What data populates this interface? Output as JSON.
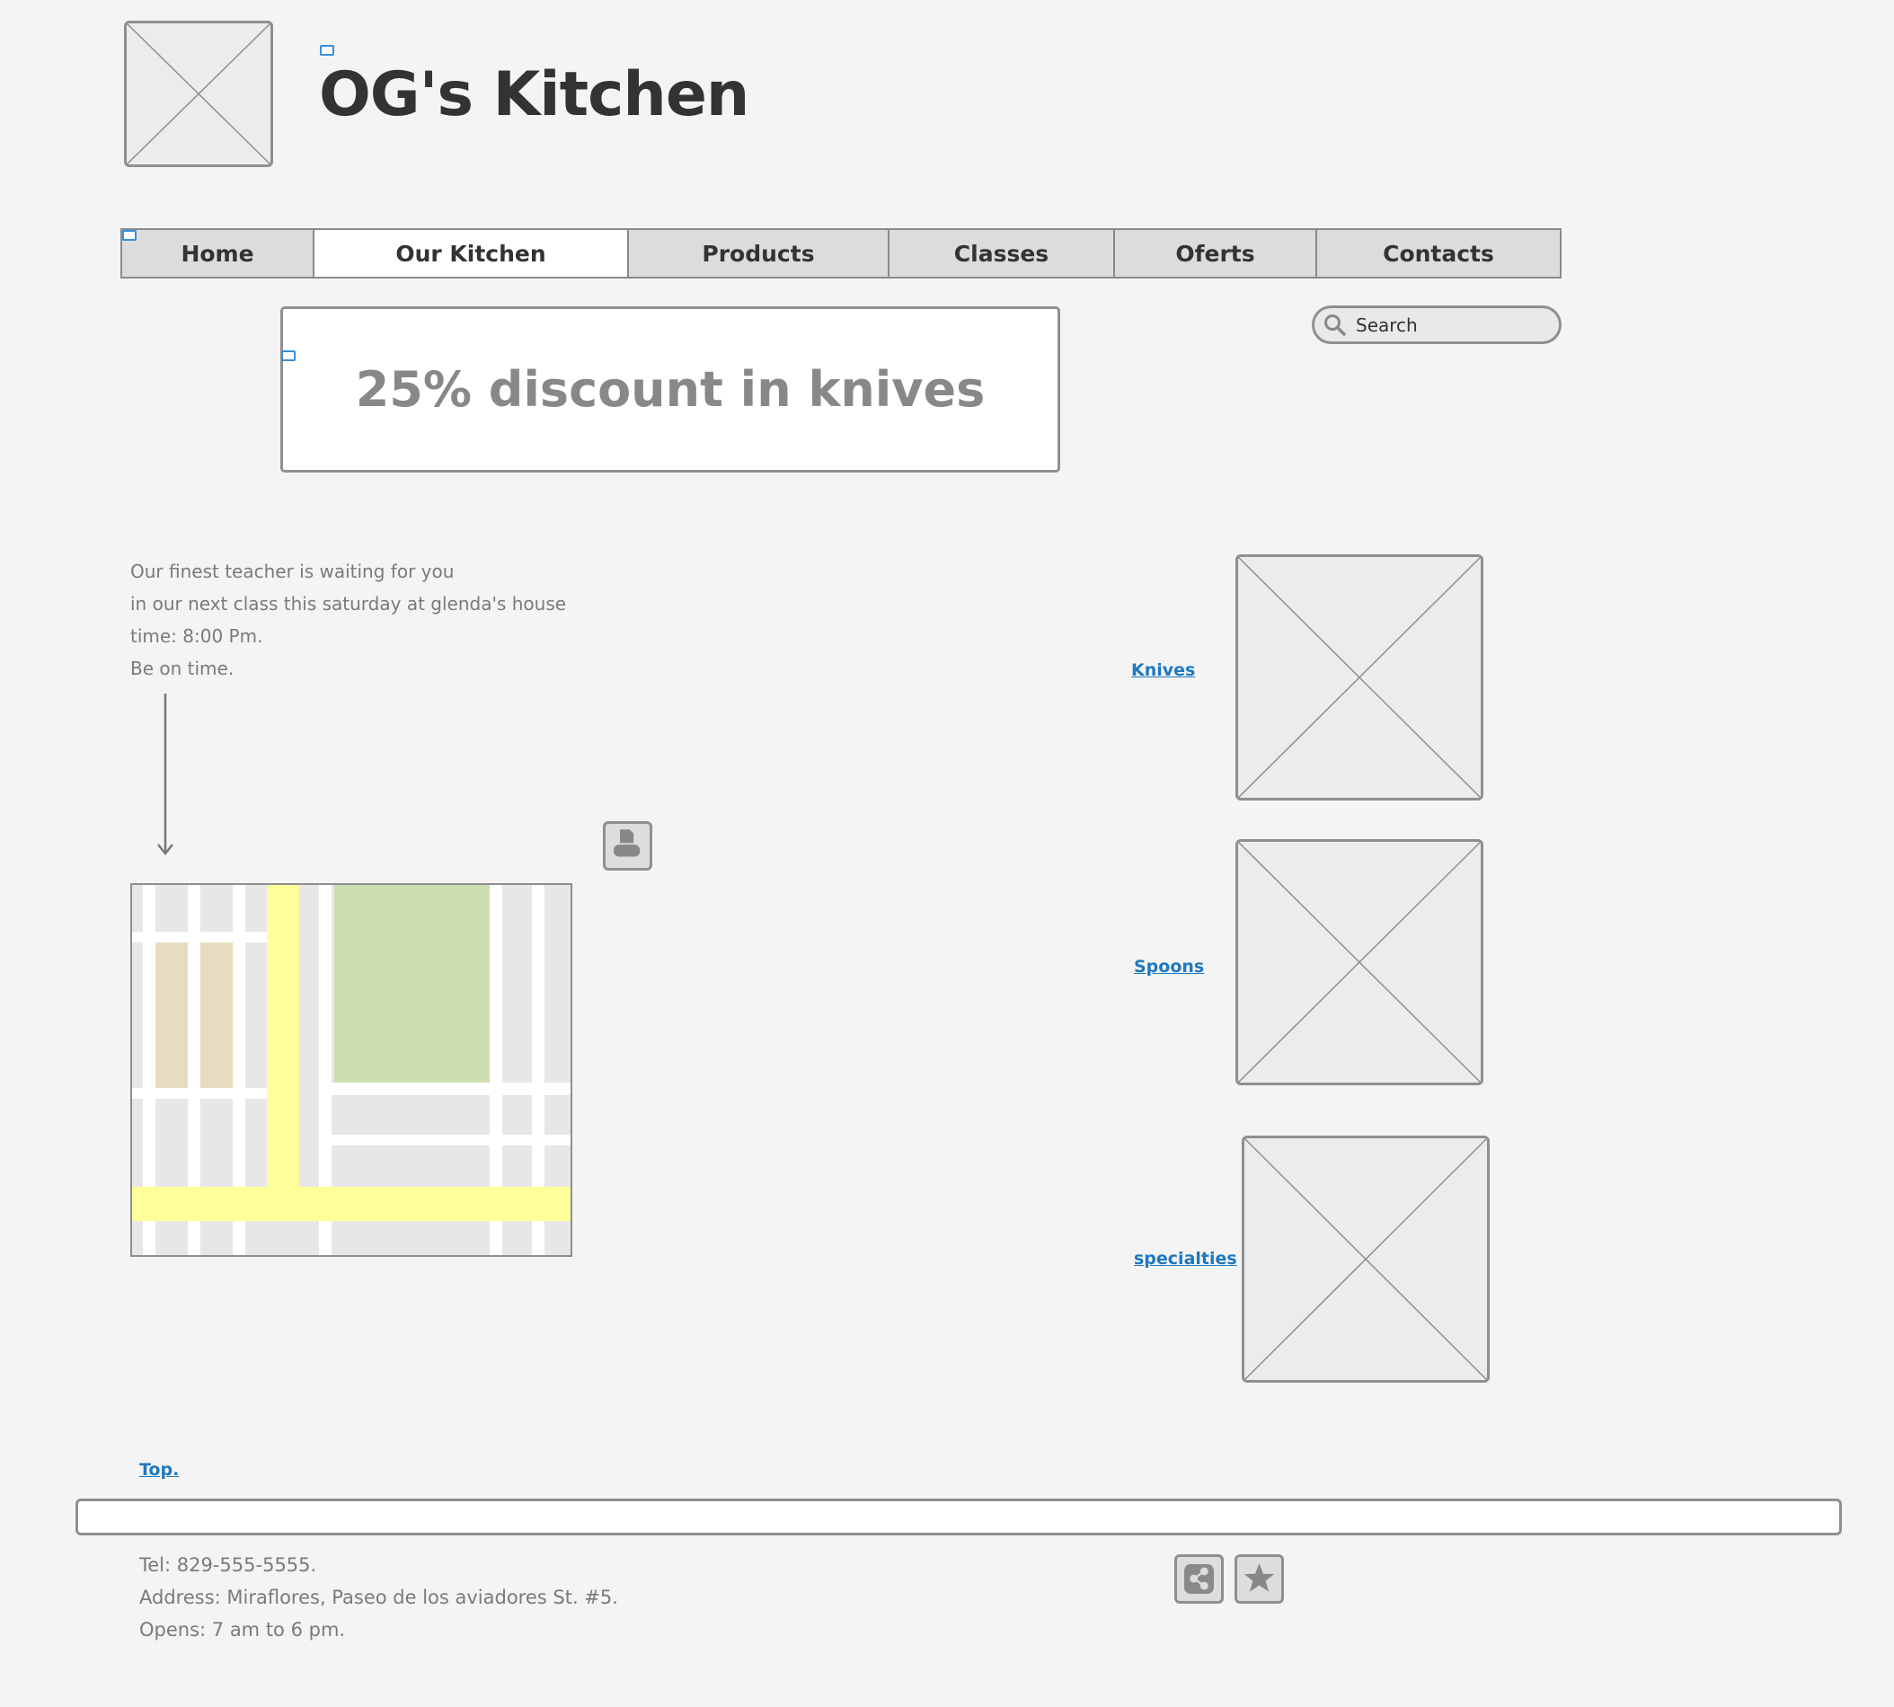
{
  "header": {
    "site_title": "OG's Kitchen"
  },
  "nav": {
    "tabs": [
      {
        "label": "Home"
      },
      {
        "label": "Our Kitchen"
      },
      {
        "label": "Products"
      },
      {
        "label": "Classes"
      },
      {
        "label": "Oferts"
      },
      {
        "label": "Contacts"
      }
    ],
    "active_tab": "Our Kitchen"
  },
  "search": {
    "placeholder": "Search"
  },
  "banner": {
    "text": "25% discount in knives"
  },
  "info": {
    "lines": [
      "Our finest teacher is waiting for you",
      "in our next class this saturday at glenda's house",
      "time: 8:00 Pm.",
      "Be on time."
    ]
  },
  "categories": [
    {
      "label": "Knives"
    },
    {
      "label": "Spoons"
    },
    {
      "label": "specialties"
    }
  ],
  "top_link": "Top.",
  "footer": {
    "tel": "Tel: 829-555-5555.",
    "address": "Address: Miraflores, Paseo de los aviadores St. #5.",
    "hours": "Opens: 7 am to 6 pm."
  },
  "icons": {
    "print": "printer-icon",
    "share": "share-icon",
    "favorite": "star-icon",
    "search": "search-icon"
  },
  "colors": {
    "link": "#1f78c2",
    "map_road_major": "#ffff99",
    "map_park": "#cddfae",
    "map_building": "#e8dcc0"
  }
}
